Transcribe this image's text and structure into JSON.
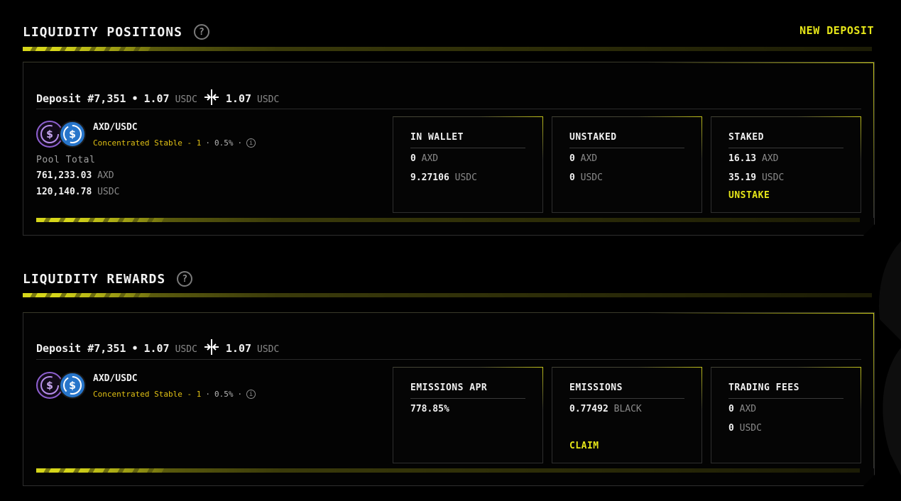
{
  "positions": {
    "title": "LIQUIDITY POSITIONS",
    "new_deposit": "NEW DEPOSIT",
    "card": {
      "deposit_label": "Deposit #7,351",
      "sep": "•",
      "low": "1.07",
      "low_unit": "USDC",
      "high": "1.07",
      "high_unit": "USDC",
      "pair": "AXD/USDC",
      "pool_type": "Concentrated Stable - 1",
      "dot1": "·",
      "fee": "0.5%",
      "dot2": "·",
      "pool_total_label": "Pool Total",
      "pool_axd": "761,233.03",
      "pool_axd_unit": "AXD",
      "pool_usdc": "120,140.78",
      "pool_usdc_unit": "USDC",
      "boxes": {
        "wallet": {
          "title": "IN WALLET",
          "v1": "0",
          "u1": "AXD",
          "v2": "9.27106",
          "u2": "USDC"
        },
        "unstaked": {
          "title": "UNSTAKED",
          "v1": "0",
          "u1": "AXD",
          "v2": "0",
          "u2": "USDC"
        },
        "staked": {
          "title": "STAKED",
          "v1": "16.13",
          "u1": "AXD",
          "v2": "35.19",
          "u2": "USDC",
          "action": "UNSTAKE"
        }
      }
    }
  },
  "rewards": {
    "title": "LIQUIDITY REWARDS",
    "card": {
      "deposit_label": "Deposit #7,351",
      "sep": "•",
      "low": "1.07",
      "low_unit": "USDC",
      "high": "1.07",
      "high_unit": "USDC",
      "pair": "AXD/USDC",
      "pool_type": "Concentrated Stable - 1",
      "dot1": "·",
      "fee": "0.5%",
      "dot2": "·",
      "boxes": {
        "apr": {
          "title": "EMISSIONS APR",
          "v1": "778.85%"
        },
        "emissions": {
          "title": "EMISSIONS",
          "v1": "0.77492",
          "u1": "BLACK",
          "action": "CLAIM"
        },
        "fees": {
          "title": "TRADING FEES",
          "v1": "0",
          "u1": "AXD",
          "v2": "0",
          "u2": "USDC"
        }
      }
    }
  },
  "icons": {
    "help": "question-circle-icon",
    "info": "info-circle-icon",
    "range": "range-arrows-icon",
    "axd": "axd-token-icon",
    "usdc": "usdc-token-icon"
  },
  "colors": {
    "accent": "#e6e619",
    "pool_type": "#e0c014",
    "usdc": "#2775ca",
    "axd": "#8e5fd0"
  }
}
